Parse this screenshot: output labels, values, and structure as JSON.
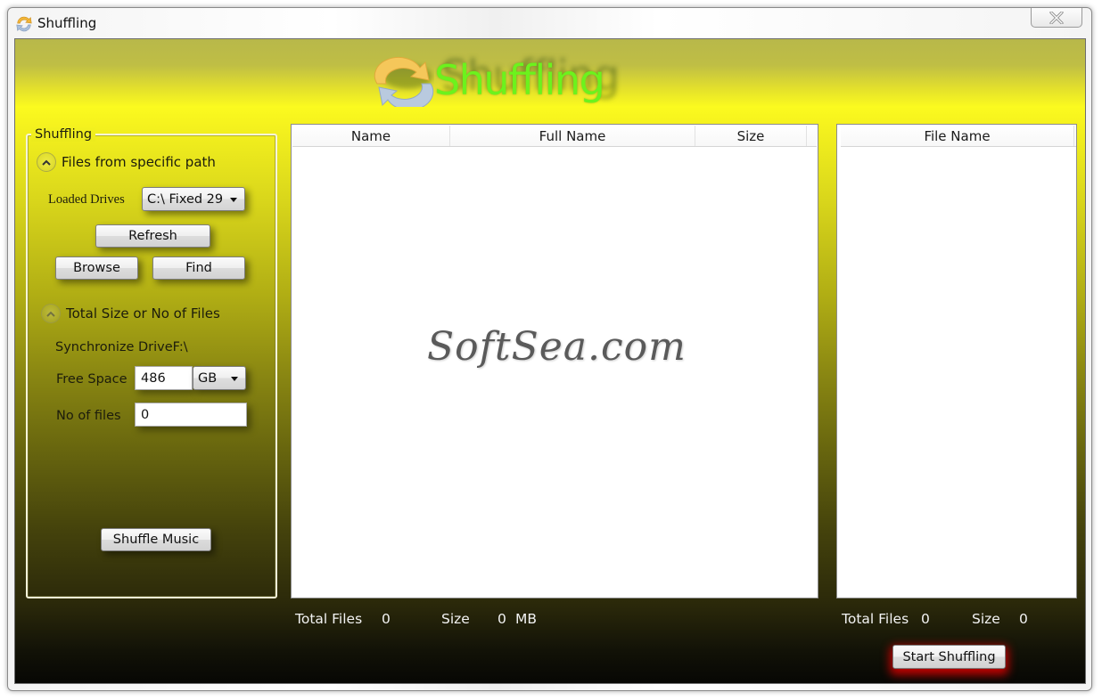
{
  "window": {
    "title": "Shuffling",
    "app_icon": "refresh-arrows-icon",
    "close_icon": "close-icon"
  },
  "header": {
    "logo_text": "Shuffling",
    "logo_icon": "refresh-arrows-icon"
  },
  "left_panel": {
    "group_title": "Shuffling",
    "section1": {
      "expander_label": "Files from specific path",
      "loaded_drives_label": "Loaded Drives",
      "loaded_drives_selected": "C:\\ Fixed 29",
      "refresh_label": "Refresh",
      "browse_label": "Browse",
      "find_label": "Find"
    },
    "section2": {
      "expander_label": "Total Size or No of Files",
      "sync_drive_label": "Synchronize DriveF:\\",
      "free_space_label": "Free Space",
      "free_space_value": "486",
      "unit_selected": "GB",
      "no_of_files_label": "No of files",
      "no_of_files_value": "0"
    },
    "shuffle_music_label": "Shuffle Music"
  },
  "source_list": {
    "columns": [
      "Name",
      "Full Name",
      "Size"
    ],
    "rows": [],
    "watermark": "SoftSea.com"
  },
  "target_list": {
    "columns": [
      "File Name"
    ],
    "rows": []
  },
  "source_status": {
    "total_files_label": "Total Files",
    "total_files_value": "0",
    "size_label": "Size",
    "size_value": "0",
    "size_unit": "MB"
  },
  "target_status": {
    "total_files_label": "Total Files",
    "total_files_value": "0",
    "size_label": "Size",
    "size_value": "0"
  },
  "start_shuffling_label": "Start Shuffling",
  "colors": {
    "logo_green": "#6cf21d",
    "accent_yellow": "#fbfa1f",
    "glow_red": "#dc0000"
  }
}
